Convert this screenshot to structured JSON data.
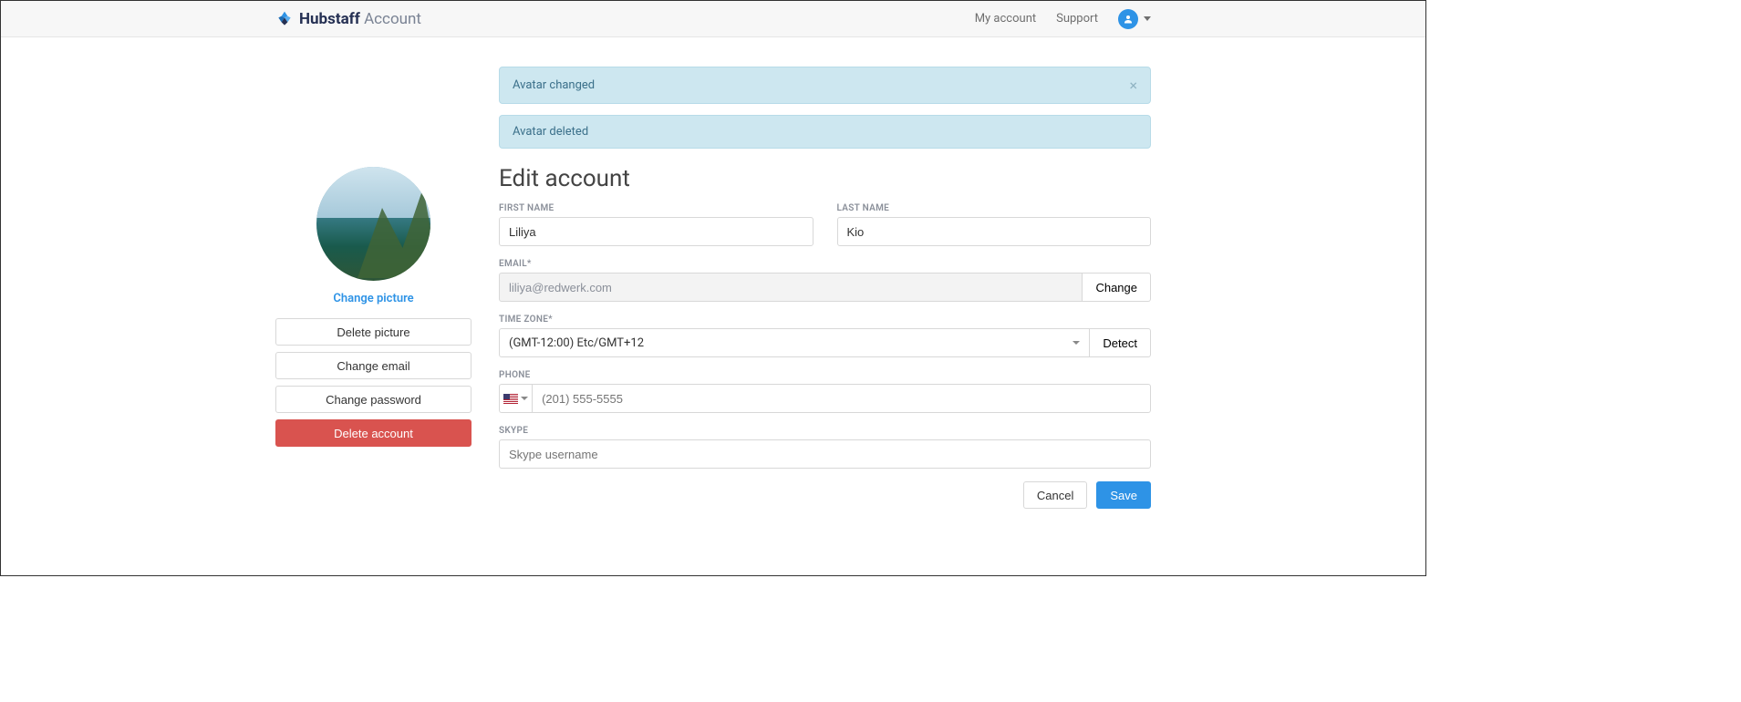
{
  "header": {
    "brand_strong": "Hubstaff",
    "brand_light": "Account",
    "nav_my_account": "My account",
    "nav_support": "Support"
  },
  "alerts": {
    "avatar_changed": "Avatar changed",
    "avatar_deleted": "Avatar deleted"
  },
  "sidebar": {
    "change_picture": "Change picture",
    "delete_picture": "Delete picture",
    "change_email": "Change email",
    "change_password": "Change password",
    "delete_account": "Delete account"
  },
  "form": {
    "title": "Edit account",
    "labels": {
      "first_name": "FIRST NAME",
      "last_name": "LAST NAME",
      "email": "EMAIL*",
      "time_zone": "TIME ZONE*",
      "phone": "PHONE",
      "skype": "SKYPE"
    },
    "values": {
      "first_name": "Liliya",
      "last_name": "Kio",
      "email": "liliya@redwerk.com",
      "time_zone": "(GMT-12:00) Etc/GMT+12",
      "phone": "",
      "skype": ""
    },
    "placeholders": {
      "phone": "(201) 555-5555",
      "skype": "Skype username"
    },
    "buttons": {
      "change_email": "Change",
      "detect_tz": "Detect",
      "cancel": "Cancel",
      "save": "Save"
    }
  }
}
